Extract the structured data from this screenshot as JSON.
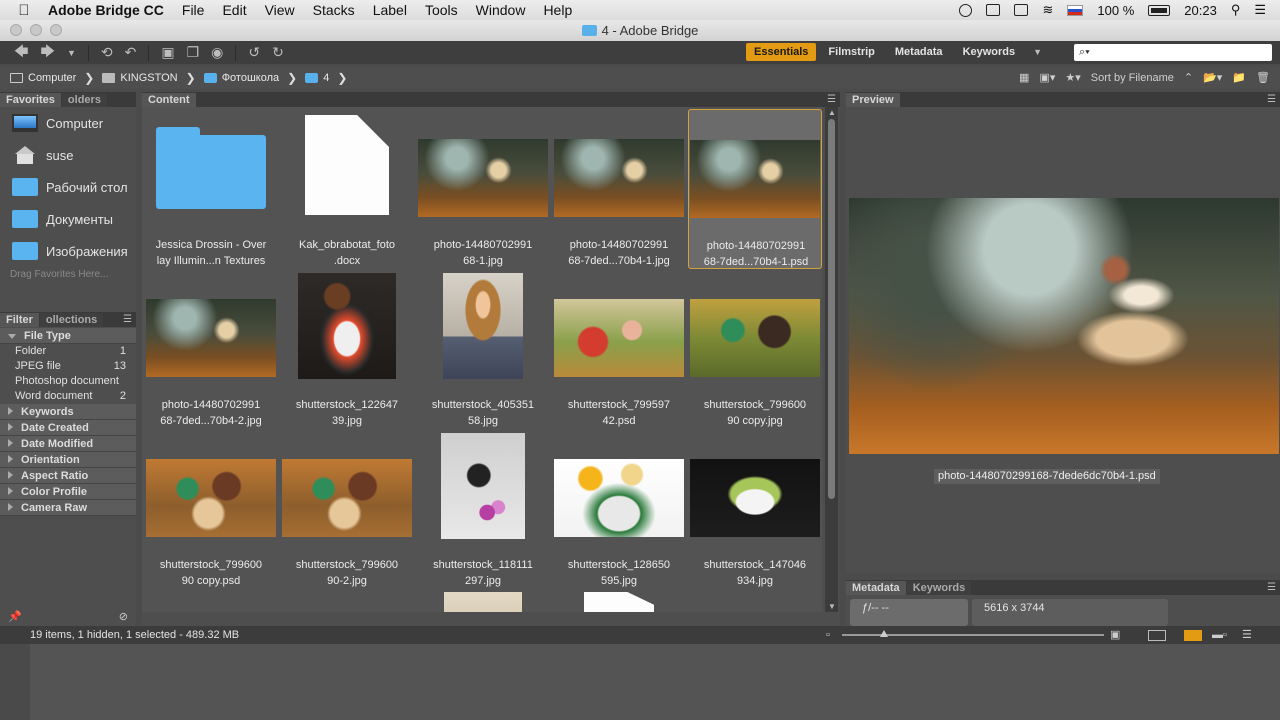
{
  "menubar": {
    "app": "Adobe Bridge CC",
    "items": [
      "File",
      "Edit",
      "View",
      "Stacks",
      "Label",
      "Tools",
      "Window",
      "Help"
    ],
    "battery": "100 %",
    "clock": "20:23"
  },
  "window": {
    "title": "4 - Adobe Bridge"
  },
  "toolbar": {
    "workspaces": [
      "Essentials",
      "Filmstrip",
      "Metadata",
      "Keywords"
    ],
    "active_workspace": "Essentials",
    "search_placeholder": "⌕▾"
  },
  "path": {
    "crumbs": [
      {
        "label": "Computer",
        "icon": "computer-icon"
      },
      {
        "label": "KINGSTON",
        "icon": "drive-icon"
      },
      {
        "label": "Фотошкола",
        "icon": "folder-icon"
      },
      {
        "label": "4",
        "icon": "folder-icon"
      }
    ],
    "sort_label": "Sort by Filename"
  },
  "favorites": {
    "tabs": [
      "Favorites",
      "olders"
    ],
    "items": [
      {
        "label": "Computer",
        "icon": "computer-icon"
      },
      {
        "label": "suse",
        "icon": "home-icon"
      },
      {
        "label": "Рабочий стол",
        "icon": "folder-icon"
      },
      {
        "label": "Документы",
        "icon": "folder-icon"
      },
      {
        "label": "Изображения",
        "icon": "folder-icon"
      }
    ],
    "drag_hint": "Drag Favorites Here..."
  },
  "filter": {
    "tabs": [
      "Filter",
      "ollections"
    ],
    "file_type_label": "File Type",
    "file_types": [
      {
        "label": "Folder",
        "count": "1"
      },
      {
        "label": "JPEG file",
        "count": "13"
      },
      {
        "label": "Photoshop document",
        "count": ""
      },
      {
        "label": "Word document",
        "count": "2"
      }
    ],
    "sections": [
      "Keywords",
      "Date Created",
      "Date Modified",
      "Orientation",
      "Aspect Ratio",
      "Color Profile",
      "Camera Raw"
    ]
  },
  "content": {
    "tab": "Content",
    "items": [
      {
        "name1": "Jessica Drossin - Over",
        "name2": "lay Illumin...n Textures",
        "kind": "folder"
      },
      {
        "name1": "Kak_obrabotat_foto",
        "name2": ".docx",
        "kind": "doc"
      },
      {
        "name1": "photo-14480702991",
        "name2": "68-1.jpg",
        "kind": "forest"
      },
      {
        "name1": "photo-14480702991",
        "name2": "68-7ded...70b4-1.jpg",
        "kind": "forest"
      },
      {
        "name1": "photo-14480702991",
        "name2": "68-7ded...70b4-1.psd",
        "kind": "forest",
        "selected": true
      },
      {
        "name1": "photo-14480702991",
        "name2": "68-7ded...70b4-2.jpg",
        "kind": "forest"
      },
      {
        "name1": "shutterstock_122647",
        "name2": "39.jpg",
        "kind": "sushi"
      },
      {
        "name1": "shutterstock_405351",
        "name2": "58.jpg",
        "kind": "girl"
      },
      {
        "name1": "shutterstock_799597",
        "name2": "42.psd",
        "kind": "kids1"
      },
      {
        "name1": "shutterstock_799600",
        "name2": "90 copy.jpg",
        "kind": "kids2"
      },
      {
        "name1": "shutterstock_799600",
        "name2": "90 copy.psd",
        "kind": "mom"
      },
      {
        "name1": "shutterstock_799600",
        "name2": "90-2.jpg",
        "kind": "mom"
      },
      {
        "name1": "shutterstock_118111",
        "name2": "297.jpg",
        "kind": "bal"
      },
      {
        "name1": "shutterstock_128650",
        "name2": "595.jpg",
        "kind": "flower"
      },
      {
        "name1": "shutterstock_147046",
        "name2": "934.jpg",
        "kind": "salad"
      }
    ]
  },
  "preview": {
    "tab": "Preview",
    "filename": "photo-1448070299168-7dede6dc70b4-1.psd"
  },
  "metadata": {
    "tabs": [
      "Metadata",
      "Keywords"
    ],
    "exposure": "ƒ/--      --",
    "dimensions": "5616 x 3744"
  },
  "status": {
    "text": "19 items, 1 hidden, 1 selected - 489.32 MB",
    "zoom_fraction": 0.16
  },
  "colors": {
    "accent": "#e29b13",
    "folder": "#5ab4ef",
    "selection": "#d5a23a"
  }
}
